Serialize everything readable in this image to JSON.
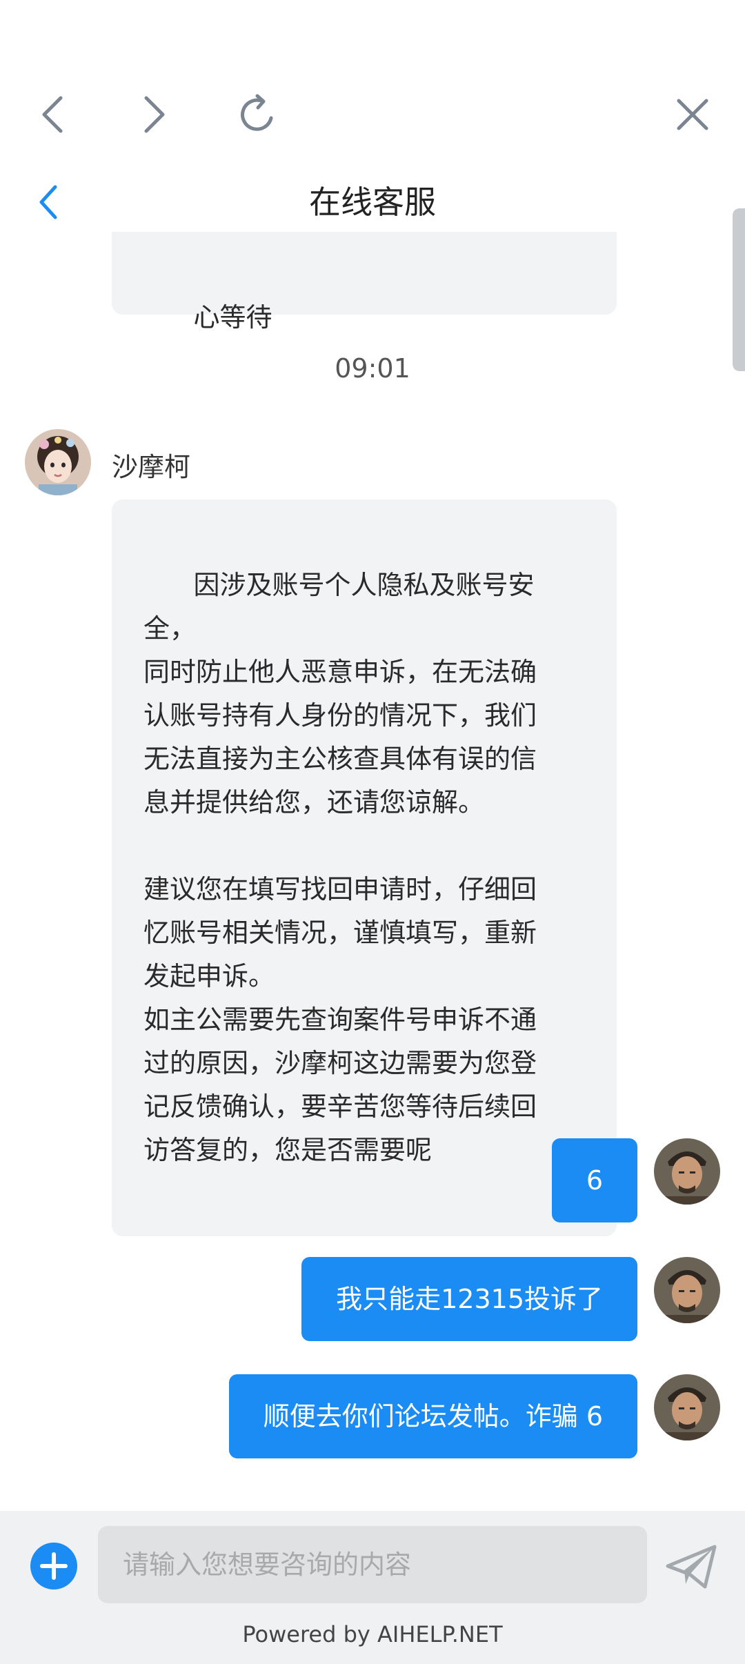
{
  "browser": {
    "back_icon": "chevron-left-icon",
    "forward_icon": "chevron-right-icon",
    "reload_icon": "refresh-icon",
    "close_icon": "close-icon"
  },
  "header": {
    "title": "在线客服",
    "back_icon": "chevron-left-icon"
  },
  "colors": {
    "accent": "#1c8cf5",
    "agent_bubble": "#f2f3f5",
    "footer_bg": "#f0f1f3"
  },
  "messages": {
    "prev_agent_tail": "心等待",
    "timestamp": "09:01",
    "agent_name": "沙摩柯",
    "agent_text": "因涉及账号个人隐私及账号安全，\n同时防止他人恶意申诉，在无法确\n认账号持有人身份的情况下，我们\n无法直接为主公核查具体有误的信\n息并提供给您，还请您谅解。\n\n建议您在填写找回申请时，仔细回\n忆账号相关情况，谨慎填写，重新\n发起申诉。\n如主公需要先查询案件号申诉不通\n过的原因，沙摩柯这边需要为您登\n记反馈确认，要辛苦您等待后续回\n访答复的，您是否需要呢",
    "user_1": "6",
    "user_2": "我只能走12315投诉了",
    "user_3": "顺便去你们论坛发帖。诈骗 6"
  },
  "footer": {
    "plus_icon": "plus-circle-icon",
    "input_placeholder": "请输入您想要咨询的内容",
    "send_icon": "send-icon",
    "powered_by": "Powered by AIHELP.NET"
  }
}
